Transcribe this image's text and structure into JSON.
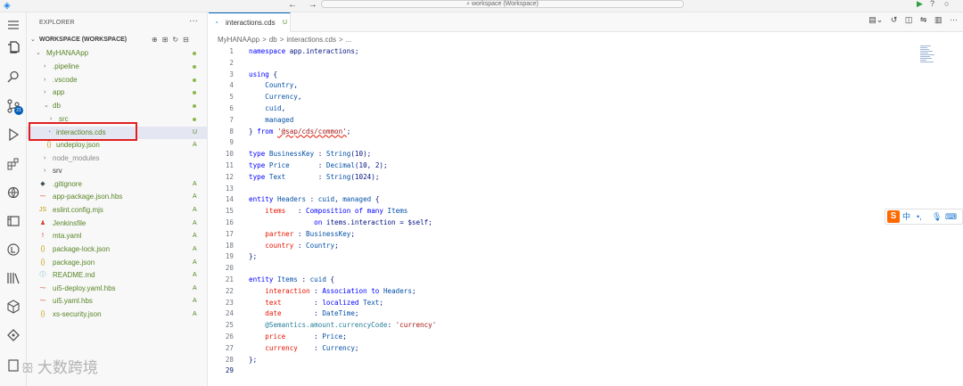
{
  "titlebar": {
    "back": "←",
    "forward": "→",
    "command_center": "⌕ workspace (Workspace)"
  },
  "activity_bar": {
    "scm_badge": "21"
  },
  "sidebar": {
    "title": "EXPLORER",
    "more": "···",
    "workspace_label": "WORKSPACE (WORKSPACE)",
    "items": [
      {
        "name": "MyHANAApp",
        "status": "dot",
        "status_text": "",
        "color": "green"
      },
      {
        "name": ".pipeline",
        "status": "dot",
        "status_text": "",
        "color": "green"
      },
      {
        "name": ".vscode",
        "status": "dot",
        "status_text": "",
        "color": "green"
      },
      {
        "name": "app",
        "status": "dot",
        "status_text": "",
        "color": "green"
      },
      {
        "name": "db",
        "status": "dot",
        "status_text": "",
        "color": "green"
      },
      {
        "name": "src",
        "status": "dot",
        "status_text": "",
        "color": "green"
      },
      {
        "name": "interactions.cds",
        "status": "text",
        "status_text": "U",
        "color": "green"
      },
      {
        "name": "undeploy.json",
        "status": "text",
        "status_text": "A",
        "color": "green"
      },
      {
        "name": "node_modules",
        "status": "none",
        "status_text": "",
        "color": "gray"
      },
      {
        "name": "srv",
        "status": "none",
        "status_text": "",
        "color": "normal"
      },
      {
        "name": ".gitignore",
        "status": "text",
        "status_text": "A",
        "color": "green"
      },
      {
        "name": "app-package.json.hbs",
        "status": "text",
        "status_text": "A",
        "color": "green"
      },
      {
        "name": "eslint.config.mjs",
        "status": "text",
        "status_text": "A",
        "color": "green"
      },
      {
        "name": "Jenkinsfile",
        "status": "text",
        "status_text": "A",
        "color": "green"
      },
      {
        "name": "mta.yaml",
        "status": "text",
        "status_text": "A",
        "color": "green"
      },
      {
        "name": "package-lock.json",
        "status": "text",
        "status_text": "A",
        "color": "green"
      },
      {
        "name": "package.json",
        "status": "text",
        "status_text": "A",
        "color": "green"
      },
      {
        "name": "README.md",
        "status": "text",
        "status_text": "A",
        "color": "green"
      },
      {
        "name": "ui5-deploy.yaml.hbs",
        "status": "text",
        "status_text": "A",
        "color": "green"
      },
      {
        "name": "ui5.yaml.hbs",
        "status": "text",
        "status_text": "A",
        "color": "green"
      },
      {
        "name": "xs-security.json",
        "status": "text",
        "status_text": "A",
        "color": "green"
      }
    ]
  },
  "editor": {
    "tab_label": "interactions.cds",
    "tab_status": "U",
    "breadcrumb": [
      "MyHANAApp",
      ">",
      "db",
      ">",
      "interactions.cds",
      ">",
      "..."
    ],
    "lines": [
      "namespace app.interactions;",
      "",
      "using {",
      "    Country,",
      "    Currency,",
      "    cuid,",
      "    managed",
      "} from '@sap/cds/common';",
      "",
      "type BusinessKey : String(10);",
      "type Price       : Decimal(10, 2);",
      "type Text        : String(1024);",
      "",
      "entity Headers : cuid, managed {",
      "    items   : Composition of many Items",
      "                on items.interaction = $self;",
      "    partner : BusinessKey;",
      "    country : Country;",
      "};",
      "",
      "entity Items : cuid {",
      "    interaction : Association to Headers;",
      "    text        : localized Text;",
      "    date        : DateTime;",
      "    @Semantics.amount.currencyCode: 'currency'",
      "    price       : Price;",
      "    currency    : Currency;",
      "};",
      ""
    ]
  },
  "ime": {
    "logo": "S",
    "lang": "中",
    "punct": "•,",
    "mic": "🎙",
    "keyboard": "⌨"
  },
  "watermark": {
    "text": "大数跨境"
  }
}
